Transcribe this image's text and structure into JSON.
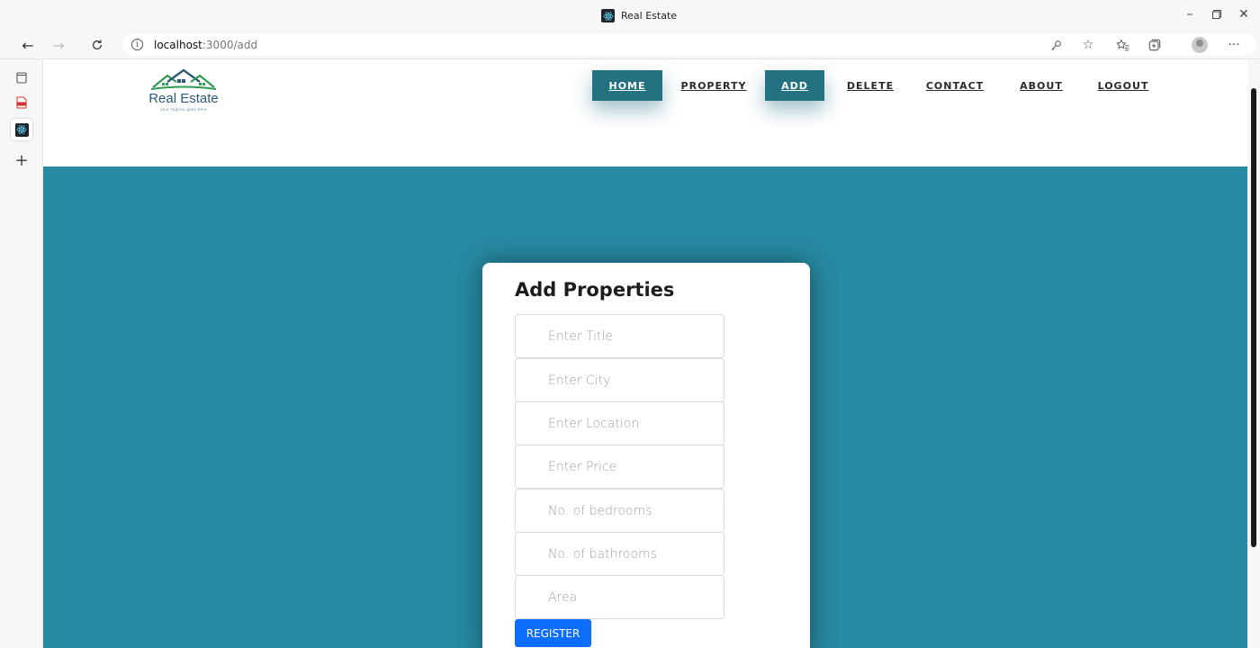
{
  "browser": {
    "tab_title": "Real Estate",
    "url_host": "localhost",
    "url_path": ":3000/add",
    "icons": {
      "back": "arrow-left-icon",
      "forward": "arrow-right-icon",
      "refresh": "refresh-icon",
      "info": "info-icon",
      "key": "key-icon",
      "favorites_add": "star-plus-icon",
      "favorites": "favorites-icon",
      "collections": "collections-icon",
      "profile": "profile-avatar-icon",
      "more": "more-icon"
    }
  },
  "sidebar": {
    "items": [
      {
        "icon": "tab-icon"
      },
      {
        "icon": "pdf-icon"
      },
      {
        "icon": "react-icon"
      },
      {
        "icon": "plus-icon"
      }
    ]
  },
  "site": {
    "logo_text": "Real Estate",
    "logo_tagline": "your tagline goes here",
    "nav": [
      {
        "label": "HOME",
        "active": true
      },
      {
        "label": "PROPERTY",
        "active": false
      },
      {
        "label": "ADD",
        "active": true
      },
      {
        "label": "DELETE",
        "active": false
      },
      {
        "label": "CONTACT",
        "active": false
      },
      {
        "label": "ABOUT",
        "active": false
      },
      {
        "label": "LOGOUT",
        "active": false
      }
    ]
  },
  "form": {
    "title": "Add Properties",
    "fields": [
      {
        "placeholder": "Enter Title",
        "value": ""
      },
      {
        "placeholder": "Enter City",
        "value": ""
      },
      {
        "placeholder": "Enter Location",
        "value": ""
      },
      {
        "placeholder": "Enter Price",
        "value": ""
      },
      {
        "placeholder": "No. of bedrooms",
        "value": ""
      },
      {
        "placeholder": "No. of bathrooms",
        "value": ""
      },
      {
        "placeholder": "Area",
        "value": ""
      }
    ],
    "submit_label": "REGISTER"
  },
  "colors": {
    "hero_bg": "#278ba3",
    "nav_active_bg": "#247182",
    "submit_bg": "#0d6efd",
    "logo_green": "#2f9a53",
    "logo_blue": "#2e5a78"
  }
}
